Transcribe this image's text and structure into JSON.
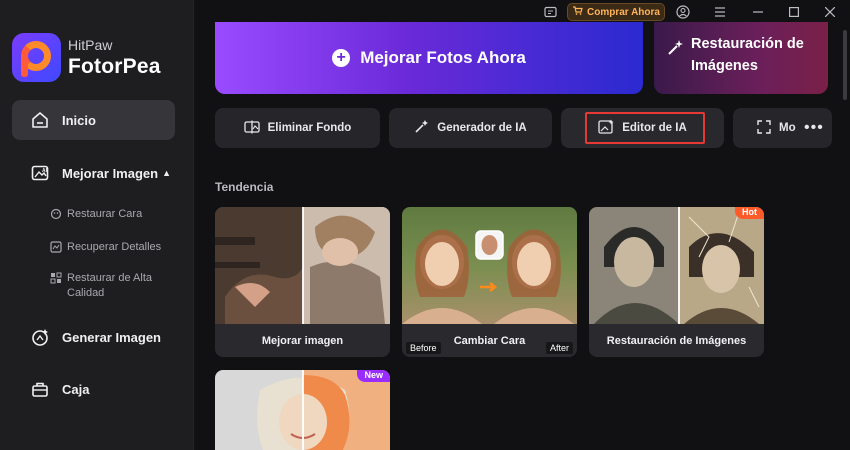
{
  "brand": {
    "line1": "HitPaw",
    "line2": "FotorPea"
  },
  "titlebar": {
    "buy_label": "Comprar Ahora"
  },
  "sidebar": {
    "items": [
      {
        "label": "Inicio"
      },
      {
        "label": "Mejorar Imagen"
      },
      {
        "label": "Generar Imagen"
      },
      {
        "label": "Caja"
      }
    ],
    "sub_items": [
      {
        "label": "Restaurar Cara"
      },
      {
        "label": "Recuperar Detalles"
      },
      {
        "label": "Restaurar de Alta Calidad"
      }
    ]
  },
  "banners": {
    "main": "Mejorar Fotos Ahora",
    "side_line1": "Restauración de",
    "side_line2": "Imágenes"
  },
  "tools": [
    {
      "label": "Eliminar Fondo"
    },
    {
      "label": "Generador de IA"
    },
    {
      "label": "Editor de IA"
    },
    {
      "label": "Mo"
    }
  ],
  "section": {
    "title": "Tendencia"
  },
  "cards": [
    {
      "caption": "Mejorar imagen"
    },
    {
      "caption": "Cambiar Cara",
      "before": "Before",
      "after": "After"
    },
    {
      "caption": "Restauración de Imágenes",
      "badge": "Hot"
    },
    {
      "caption": "",
      "badge": "New"
    }
  ],
  "colors": {
    "accent": "#7a3cff",
    "hot": "#ff5a2a",
    "new": "#9b2cff",
    "highlight_border": "#e53935"
  }
}
